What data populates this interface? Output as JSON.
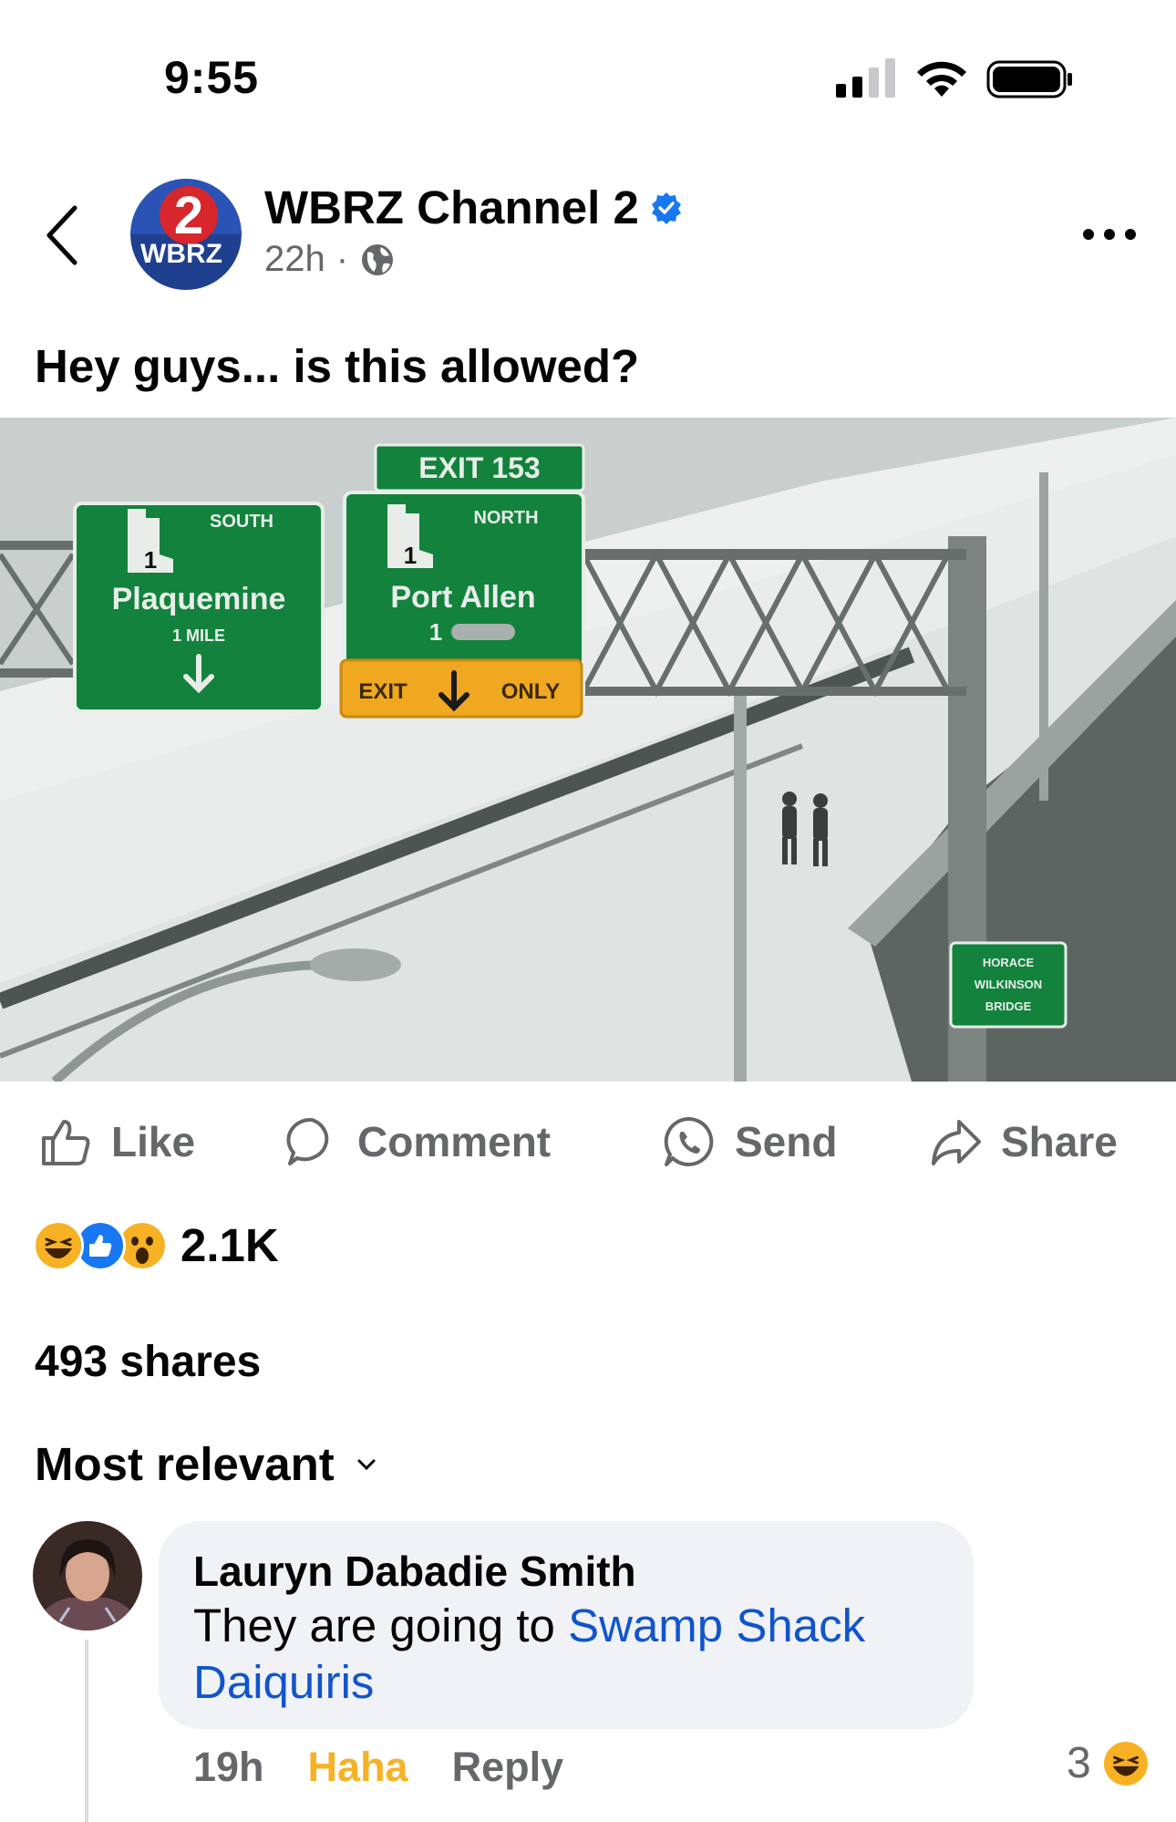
{
  "status_bar": {
    "time": "9:55"
  },
  "post": {
    "page_name": "WBRZ Channel 2",
    "logo_text": {
      "number": "2",
      "brand": "WBRZ"
    },
    "time_ago": "22h",
    "separator": "·",
    "caption": "Hey guys... is this allowed?",
    "photo": {
      "signs": {
        "exit_number": "EXIT 153",
        "south_label": "SOUTH",
        "south_route": "1",
        "south_city": "Plaquemine",
        "south_distance": "1 MILE",
        "north_label": "NORTH",
        "north_route": "1",
        "north_city": "Port Allen",
        "north_route_below": "1",
        "exit_only_left": "EXIT",
        "exit_only_right": "ONLY",
        "bridge_sign": [
          "HORACE",
          "WILKINSON",
          "BRIDGE"
        ]
      }
    }
  },
  "actions": {
    "like": "Like",
    "comment": "Comment",
    "send": "Send",
    "share": "Share"
  },
  "reactions": {
    "icons": [
      "haha-emoji",
      "like-emoji",
      "wow-emoji"
    ],
    "count": "2.1K"
  },
  "shares": "493 shares",
  "sort": {
    "label": "Most relevant"
  },
  "comment": {
    "author": "Lauryn Dabadie Smith",
    "text_prefix": "They are going to ",
    "link_text": "Swamp Shack Daiquiris",
    "time": "19h",
    "haha_label": "Haha",
    "reply_label": "Reply",
    "reaction_count": "3"
  },
  "colors": {
    "verified": "#1877f2",
    "link": "#1155cc",
    "haha": "#f7b125",
    "muted": "#65676b",
    "bubble": "#f0f2f5",
    "sign_green": "#12823c",
    "sign_yellow": "#f0a820"
  }
}
